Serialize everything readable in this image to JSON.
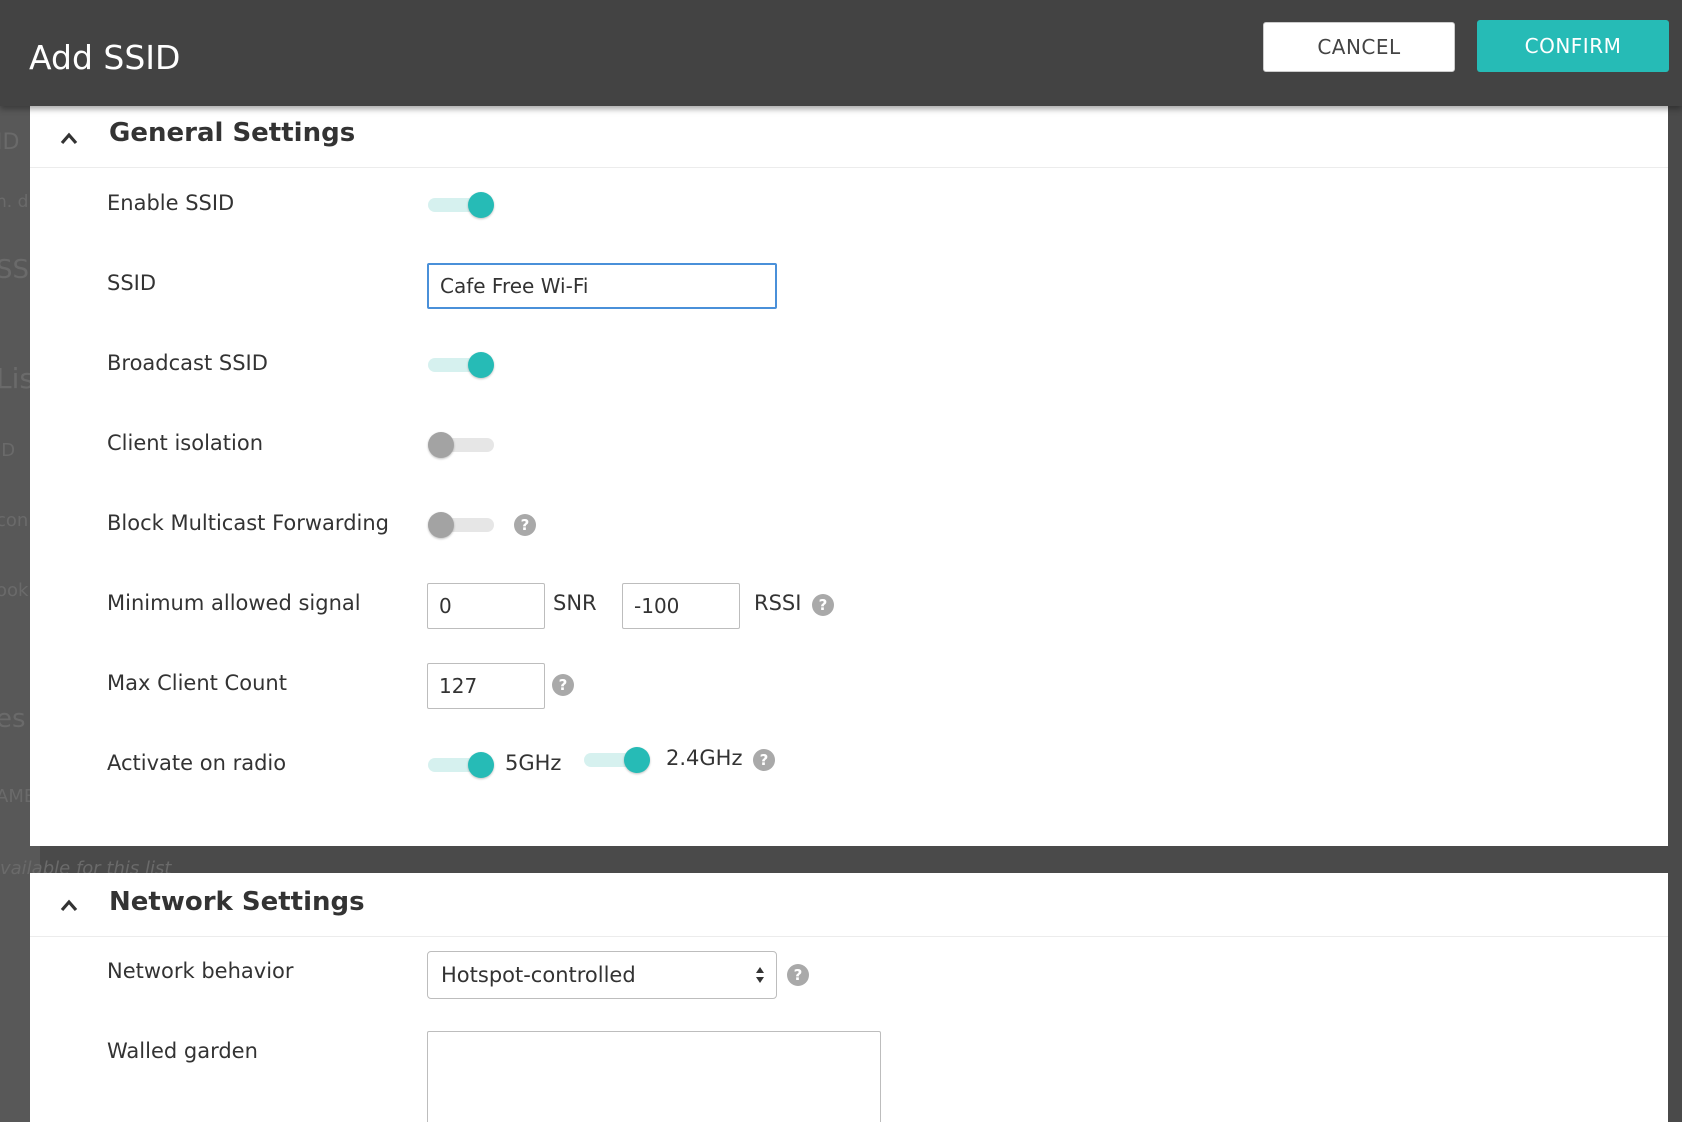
{
  "background": {
    "fragments": [
      "ID",
      "n. d",
      "SSI",
      "Lis",
      "ID",
      "con",
      "ook",
      "es",
      "AME"
    ],
    "note": "vailable for this list"
  },
  "header": {
    "title": "Add SSID",
    "cancel_label": "CANCEL",
    "confirm_label": "CONFIRM"
  },
  "general": {
    "title": "General Settings",
    "enable_ssid": {
      "label": "Enable SSID",
      "on": true
    },
    "ssid": {
      "label": "SSID",
      "value": "Cafe Free Wi-Fi"
    },
    "broadcast_ssid": {
      "label": "Broadcast SSID",
      "on": true
    },
    "client_isolation": {
      "label": "Client isolation",
      "on": false
    },
    "block_multicast": {
      "label": "Block Multicast Forwarding",
      "on": false
    },
    "min_signal": {
      "label": "Minimum allowed signal",
      "snr_value": "0",
      "snr_unit": "SNR",
      "rssi_value": "-100",
      "rssi_unit": "RSSI"
    },
    "max_clients": {
      "label": "Max Client Count",
      "value": "127"
    },
    "radio": {
      "label": "Activate on radio",
      "band_5_label": "5GHz",
      "band_5_on": true,
      "band_24_label": "2.4GHz",
      "band_24_on": true
    }
  },
  "network": {
    "title": "Network Settings",
    "behavior": {
      "label": "Network behavior",
      "value": "Hotspot-controlled"
    },
    "walled_garden": {
      "label": "Walled garden",
      "value": ""
    }
  },
  "colors": {
    "accent": "#26bbb6",
    "header_bg": "#434343",
    "focus_border": "#4a90d9"
  }
}
